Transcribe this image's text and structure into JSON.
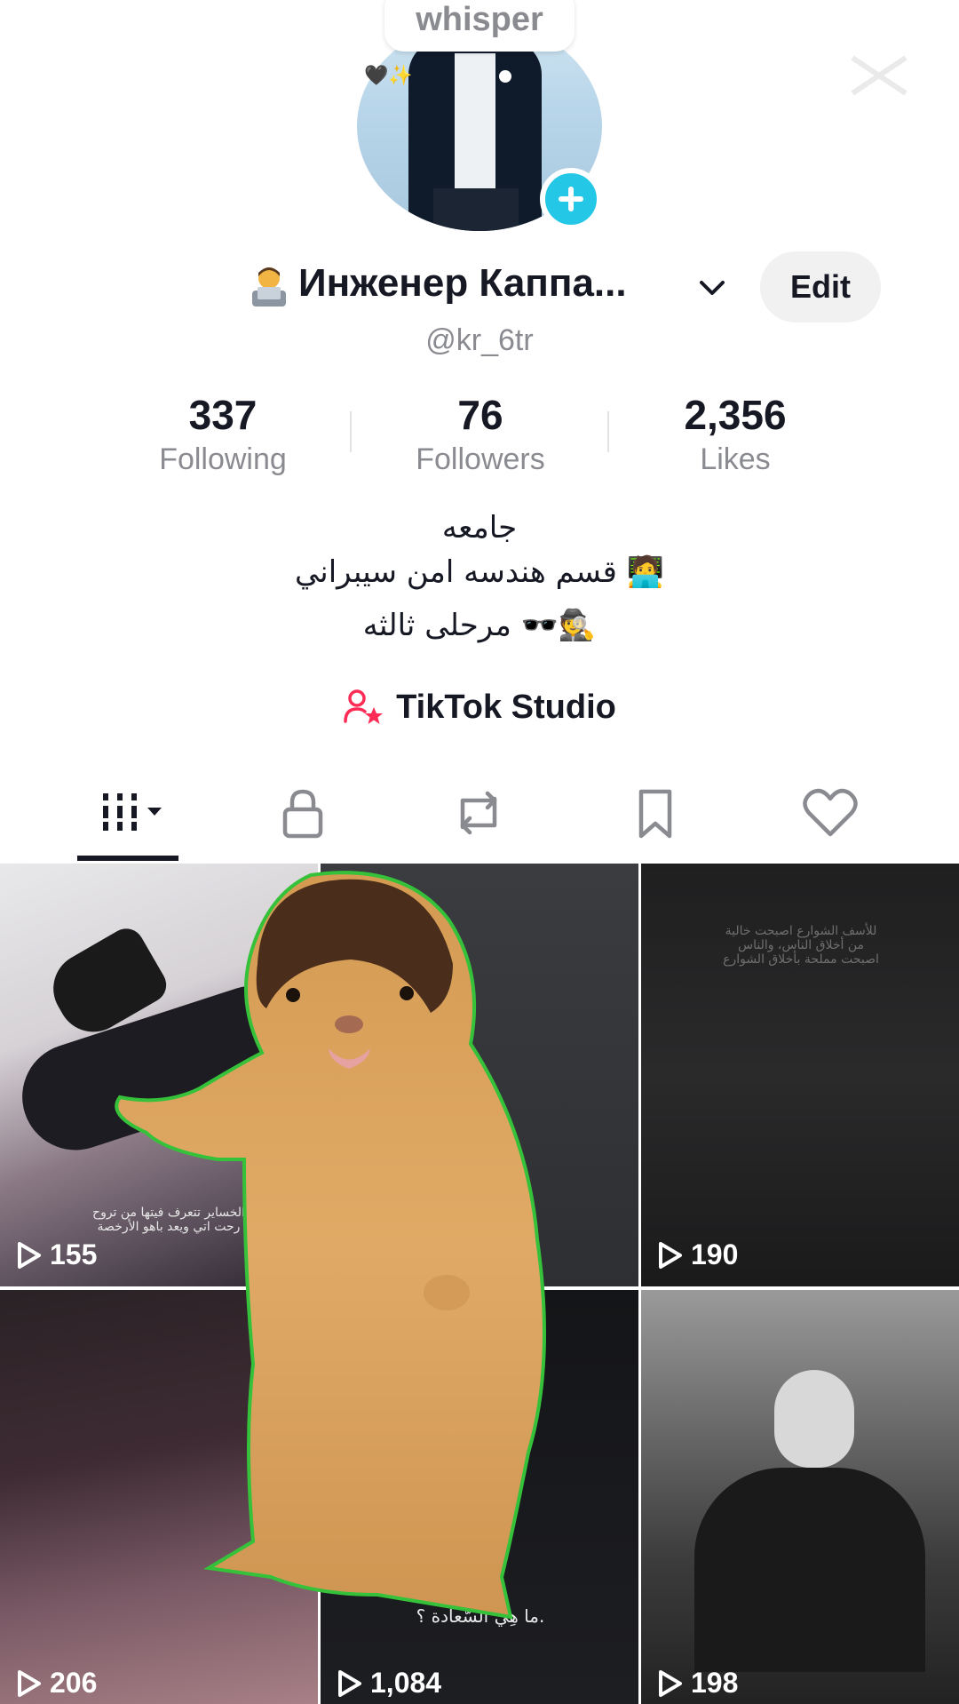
{
  "header": {
    "whisper_label": "whisper"
  },
  "profile": {
    "display_name": "Инженер Каппа...",
    "username": "@kr_6tr",
    "edit_label": "Edit"
  },
  "stats": [
    {
      "value": "337",
      "label": "Following"
    },
    {
      "value": "76",
      "label": "Followers"
    },
    {
      "value": "2,356",
      "label": "Likes"
    }
  ],
  "bio": {
    "line1": "جامعه",
    "line2": "قسم هندسه امن سيبراني 🧑‍💻",
    "line3": "مرحلى ثالثه 🕶️🕵️"
  },
  "studio": {
    "label": "TikTok Studio"
  },
  "tabs": [
    {
      "icon": "grid-icon",
      "active": true
    },
    {
      "icon": "lock-icon",
      "active": false
    },
    {
      "icon": "repost-icon",
      "active": false
    },
    {
      "icon": "bookmark-icon",
      "active": false
    },
    {
      "icon": "heart-icon",
      "active": false
    }
  ],
  "videos": [
    {
      "views": "155",
      "caption": "الخساير تتعرف فيتها من تروح\nرحت اتي ويعد باهو الأرخصة"
    },
    {
      "views": "",
      "caption": ""
    },
    {
      "views": "190",
      "caption": "للأسف الشوارع اصبحت خالية\nمن أخلاق الناس، والناس\nاصبحت مملحة بأخلاق الشوارع"
    },
    {
      "views": "206",
      "caption": ""
    },
    {
      "views": "1,084",
      "caption": "ما هِيَ السَّعادة ؟."
    },
    {
      "views": "198",
      "caption": ""
    }
  ],
  "colors": {
    "accent_cyan": "#25c7e6",
    "studio_pink": "#fe2c55",
    "text_primary": "#161823",
    "text_secondary": "#8a8b91"
  }
}
